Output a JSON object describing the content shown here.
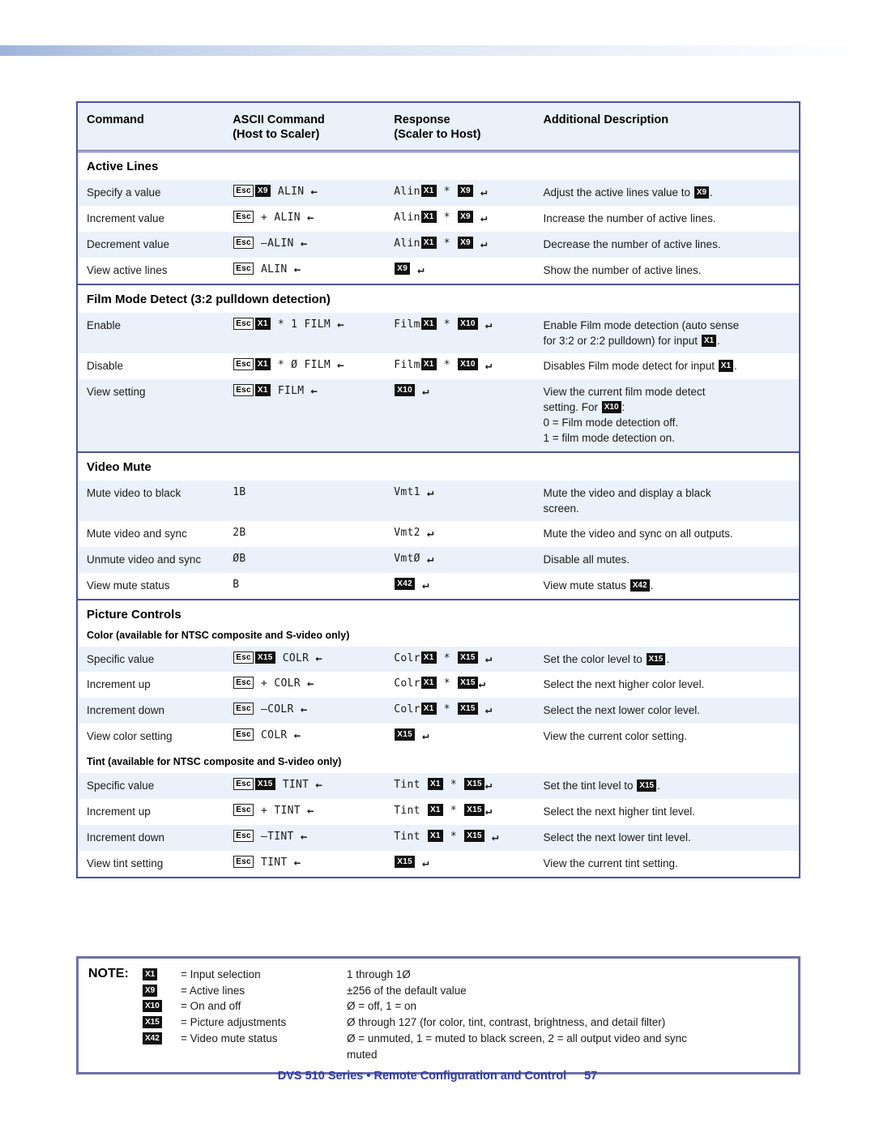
{
  "table": {
    "headers": [
      "Command",
      "ASCII Command\n(Host to Scaler)",
      "Response\n(Scaler to Host)",
      "Additional Description"
    ],
    "header_col1": "Command",
    "header_col2_l1": "ASCII Command",
    "header_col2_l2": "(Host to Scaler)",
    "header_col3_l1": "Response",
    "header_col3_l2": "(Scaler to Host)",
    "header_col4": "Additional Description",
    "sections": [
      {
        "title": "Active Lines",
        "rows": [
          {
            "command": "Specify a value"
          },
          {
            "command": "Increment value"
          },
          {
            "command": "Decrement value"
          },
          {
            "command": "View active lines"
          }
        ]
      },
      {
        "title": "Film Mode Detect (3:2 pulldown detection)",
        "rows": [
          {
            "command": "Enable"
          },
          {
            "command": "Disable"
          },
          {
            "command": "View setting"
          }
        ]
      },
      {
        "title": "Video Mute",
        "rows": [
          {
            "command": "Mute video to black",
            "ascii": "1B"
          },
          {
            "command": "Mute video and sync",
            "ascii": "2B"
          },
          {
            "command": "Unmute video and sync",
            "ascii": "ØB"
          },
          {
            "command": "View mute status",
            "ascii": "B"
          }
        ]
      },
      {
        "title": "Picture Controls",
        "subsections": [
          {
            "title": "Color (available for NTSC composite and S-video only)",
            "rows": [
              {
                "command": "Specific value"
              },
              {
                "command": "Increment up"
              },
              {
                "command": "Increment down"
              },
              {
                "command": "View color setting"
              }
            ]
          },
          {
            "title": "Tint (available for NTSC composite and S-video only)",
            "rows": [
              {
                "command": "Specific value"
              },
              {
                "command": "Increment up"
              },
              {
                "command": "Increment down"
              },
              {
                "command": "View tint setting"
              }
            ]
          }
        ]
      }
    ],
    "descriptions": {
      "alin_specify": "Adjust the active lines value to ",
      "alin_specify_end": ".",
      "alin_inc": "Increase the number of active lines.",
      "alin_dec": "Decrease the number of active lines.",
      "alin_view": "Show the number of active lines.",
      "film_enable_l1": "Enable Film mode detection (auto sense",
      "film_enable_l2a": "for 3:2 or 2:2 pulldown) for input ",
      "film_enable_l2b": ".",
      "film_disable_a": "Disables Film mode detect for input ",
      "film_disable_b": ".",
      "film_view_l1": "View the current film mode detect",
      "film_view_l2a": "setting. For ",
      "film_view_l2b": ":",
      "film_view_l3": "0 = Film mode detection off.",
      "film_view_l4": "1 = film mode detection on.",
      "mute_black_l1": "Mute the video and display a black",
      "mute_black_l2": "screen.",
      "mute_sync": "Mute the video and sync on all outputs.",
      "unmute": "Disable all mutes.",
      "view_mute_a": "View mute status ",
      "view_mute_b": ".",
      "colr_set_a": "Set the color level to ",
      "colr_set_b": ".",
      "colr_up": "Select the next higher color level.",
      "colr_down": "Select the next lower color level.",
      "colr_view": "View the current color setting.",
      "tint_set_a": "Set the tint level to ",
      "tint_set_b": ".",
      "tint_up": "Select the next higher tint level.",
      "tint_down": "Select the next lower tint level.",
      "tint_view": "View the current tint setting."
    },
    "tokens": {
      "esc": "Esc",
      "ret": "↵",
      "arrow_left": "←",
      "x1": "X1",
      "x9": "X9",
      "x10": "X10",
      "x15": "X15",
      "x42": "X42",
      "alin": "ALIN",
      "alin_resp": "Alin",
      "film": "FILM",
      "film_resp": "Film",
      "colr": "COLR",
      "colr_resp": "Colr",
      "tint": "TINT",
      "tint_resp": "Tint",
      "plus": "+",
      "minus": "—",
      "star": "*",
      "one": "1",
      "zero": "Ø",
      "vmt1": "Vmt1",
      "vmt2": "Vmt2",
      "vmt0": "VmtØ"
    }
  },
  "note": {
    "label": "NOTE:",
    "lines": [
      {
        "key": "X1",
        "definition": "= Input selection",
        "value": "1 through 1Ø"
      },
      {
        "key": "X9",
        "definition": "= Active lines",
        "value": "±256 of the default value"
      },
      {
        "key": "X10",
        "definition": "= On and off",
        "value": "Ø = off, 1 = on"
      },
      {
        "key": "X15",
        "definition": "= Picture adjustments",
        "value": "Ø through 127 (for color, tint, contrast, brightness, and detail filter)"
      },
      {
        "key": "X42",
        "definition": "= Video mute status",
        "value": "Ø = unmuted, 1 = muted to black screen, 2 = all output video and sync"
      }
    ],
    "continuation": "muted"
  },
  "footer": {
    "text": "DVS 510 Series • Remote Configuration and Control",
    "page_number": "57"
  },
  "colors": {
    "table_border": "#4a52a8",
    "header_bg": "#eaf1fa",
    "row_alt_bg": "#eaf1fa",
    "note_border": "#6f6fae",
    "footer_text": "#2e3ca0"
  }
}
